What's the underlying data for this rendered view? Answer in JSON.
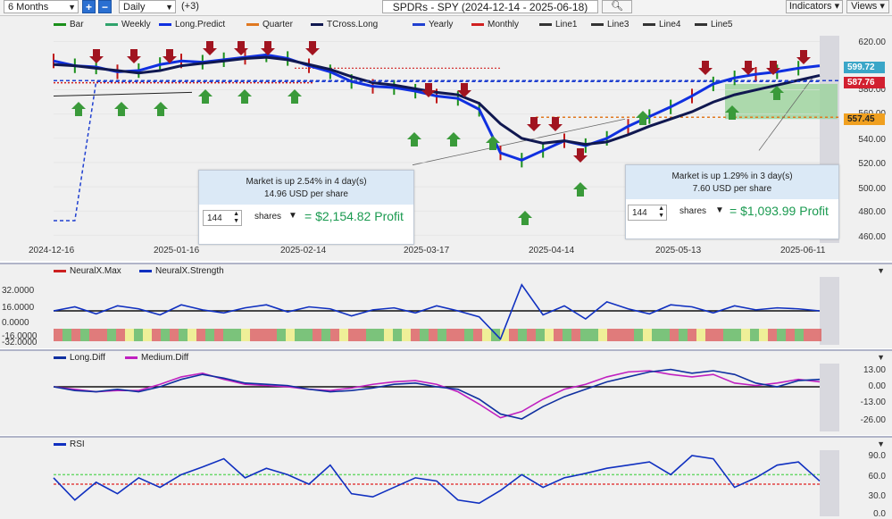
{
  "toolbar": {
    "period": "6 Months",
    "interval": "Daily",
    "plus": "+",
    "minus": "−",
    "offset": "(+3)",
    "title": "SPDRs - SPY (2024-12-14 - 2025-06-18)",
    "search_icon": "search-icon",
    "indicators": "Indicators",
    "views": "Views"
  },
  "main_panel": {
    "legend": [
      {
        "label": "Bar",
        "color": "#1a8f1a"
      },
      {
        "label": "Weekly",
        "color": "#2fa36b"
      },
      {
        "label": "Long.Predict",
        "color": "#1030e0"
      },
      {
        "label": "Quarter",
        "color": "#e07820"
      },
      {
        "label": "TCross.Long",
        "color": "#101850"
      },
      {
        "label": "Yearly",
        "color": "#2040d0"
      },
      {
        "label": "Monthly",
        "color": "#d02020"
      },
      {
        "label": "Line1",
        "color": "#333333"
      },
      {
        "label": "Line3",
        "color": "#333333"
      },
      {
        "label": "Line4",
        "color": "#333333"
      },
      {
        "label": "Line5",
        "color": "#333333"
      }
    ],
    "y_ticks": [
      "620.00",
      "580.00",
      "560.00",
      "540.00",
      "520.00",
      "500.00",
      "480.00",
      "460.00"
    ],
    "price_tags": [
      {
        "value": "599.72",
        "bg": "#3aa6c8",
        "fg": "#ffffff"
      },
      {
        "value": "587.76",
        "bg": "#d22030",
        "fg": "#ffffff"
      },
      {
        "value": "557.45",
        "bg": "#f0a020",
        "fg": "#222222"
      }
    ],
    "dates": [
      "2024-12-16",
      "2025-01-16",
      "2025-02-14",
      "2025-03-17",
      "2025-04-14",
      "2025-05-13",
      "2025-06-11"
    ]
  },
  "popup_left": {
    "line1": "Market is up 2.54% in 4 day(s)",
    "line2": "14.96 USD per share",
    "shares_count": "144",
    "shares_label": "shares",
    "profit": "= $2,154.82 Profit"
  },
  "popup_right": {
    "line1": "Market is up 1.29% in 3 day(s)",
    "line2": "7.60 USD per share",
    "shares_count": "144",
    "shares_label": "shares",
    "profit": "= $1,093.99 Profit"
  },
  "neural_panel": {
    "legend": [
      {
        "label": "NeuralX.Max",
        "color": "#cc2020"
      },
      {
        "label": "NeuralX.Strength",
        "color": "#1030c0"
      }
    ],
    "y_ticks": [
      "32.0000",
      "16.0000",
      "0.0000",
      "-16.0000",
      "-32.0000"
    ]
  },
  "diff_panel": {
    "legend": [
      {
        "label": "Long.Diff",
        "color": "#1030a0"
      },
      {
        "label": "Medium.Diff",
        "color": "#c020c0"
      }
    ],
    "y_ticks": [
      "13.00",
      "0.00",
      "-13.00",
      "-26.00"
    ]
  },
  "rsi_panel": {
    "legend": [
      {
        "label": "RSI",
        "color": "#1030c0"
      }
    ],
    "y_ticks": [
      "90.0",
      "60.0",
      "30.0",
      "0.0"
    ]
  },
  "chart_data": [
    {
      "type": "line",
      "title": "SPDRs - SPY (2024-12-14 - 2025-06-18)",
      "xlabel": "",
      "ylabel": "",
      "x_ticks": [
        "2024-12-16",
        "2025-01-16",
        "2025-02-14",
        "2025-03-17",
        "2025-04-14",
        "2025-05-13",
        "2025-06-11"
      ],
      "ylim": [
        455,
        630
      ],
      "series": [
        {
          "name": "Long.Predict",
          "values": [
            604,
            600,
            599,
            595,
            596,
            601,
            604,
            603,
            605,
            607,
            609,
            606,
            600,
            595,
            587,
            583,
            582,
            579,
            575,
            573,
            564,
            528,
            522,
            530,
            538,
            534,
            540,
            550,
            558,
            566,
            575,
            585,
            590,
            593,
            595,
            598,
            600
          ]
        },
        {
          "name": "TCross.Long",
          "values": [
            601,
            600,
            598,
            596,
            594,
            596,
            600,
            602,
            604,
            606,
            607,
            605,
            601,
            597,
            591,
            586,
            584,
            581,
            578,
            576,
            569,
            552,
            540,
            536,
            538,
            535,
            537,
            543,
            550,
            556,
            562,
            570,
            576,
            580,
            584,
            588,
            592
          ]
        },
        {
          "name": "Yearly",
          "values": [
            472,
            472,
            587,
            587,
            587,
            587,
            587,
            587,
            587,
            587,
            587,
            587,
            587,
            587,
            587,
            587,
            587,
            587,
            587,
            587,
            587,
            587,
            587,
            587,
            587,
            587,
            587,
            587,
            587,
            587,
            587,
            587,
            587,
            587,
            587,
            587,
            587
          ]
        }
      ],
      "annotations": [
        "599.72",
        "587.76",
        "557.45"
      ]
    },
    {
      "type": "line",
      "title": "",
      "ylim": [
        -32,
        32
      ],
      "series": [
        {
          "name": "NeuralX.Strength",
          "values": [
            0,
            4,
            -3,
            5,
            2,
            -4,
            6,
            1,
            -2,
            3,
            6,
            -1,
            4,
            2,
            -5,
            1,
            3,
            -2,
            5,
            0,
            -6,
            -28,
            26,
            -4,
            5,
            -8,
            9,
            2,
            -3,
            6,
            4,
            -2,
            5,
            1,
            3,
            2,
            0
          ]
        }
      ]
    },
    {
      "type": "line",
      "title": "",
      "ylim": [
        -30,
        18
      ],
      "series": [
        {
          "name": "Long.Diff",
          "values": [
            0,
            -3,
            -4,
            -2,
            -4,
            0,
            6,
            10,
            7,
            3,
            2,
            1,
            -2,
            -4,
            -3,
            -1,
            2,
            3,
            0,
            -2,
            -10,
            -22,
            -26,
            -16,
            -8,
            -2,
            4,
            8,
            12,
            14,
            11,
            13,
            10,
            3,
            0,
            5,
            6
          ]
        },
        {
          "name": "Medium.Diff",
          "values": [
            0,
            -2,
            -4,
            -3,
            -3,
            2,
            8,
            11,
            6,
            2,
            1,
            0,
            -2,
            -3,
            -1,
            2,
            4,
            5,
            2,
            -4,
            -14,
            -25,
            -20,
            -10,
            -2,
            2,
            8,
            12,
            13,
            10,
            8,
            10,
            3,
            1,
            3,
            6,
            4
          ]
        }
      ]
    },
    {
      "type": "line",
      "title": "",
      "ylim": [
        0,
        100
      ],
      "series": [
        {
          "name": "RSI",
          "values": [
            55,
            20,
            48,
            30,
            55,
            40,
            60,
            72,
            85,
            55,
            70,
            60,
            45,
            75,
            30,
            25,
            40,
            55,
            50,
            20,
            15,
            35,
            60,
            40,
            55,
            62,
            70,
            75,
            80,
            60,
            90,
            85,
            40,
            55,
            75,
            80,
            50
          ]
        }
      ]
    }
  ]
}
